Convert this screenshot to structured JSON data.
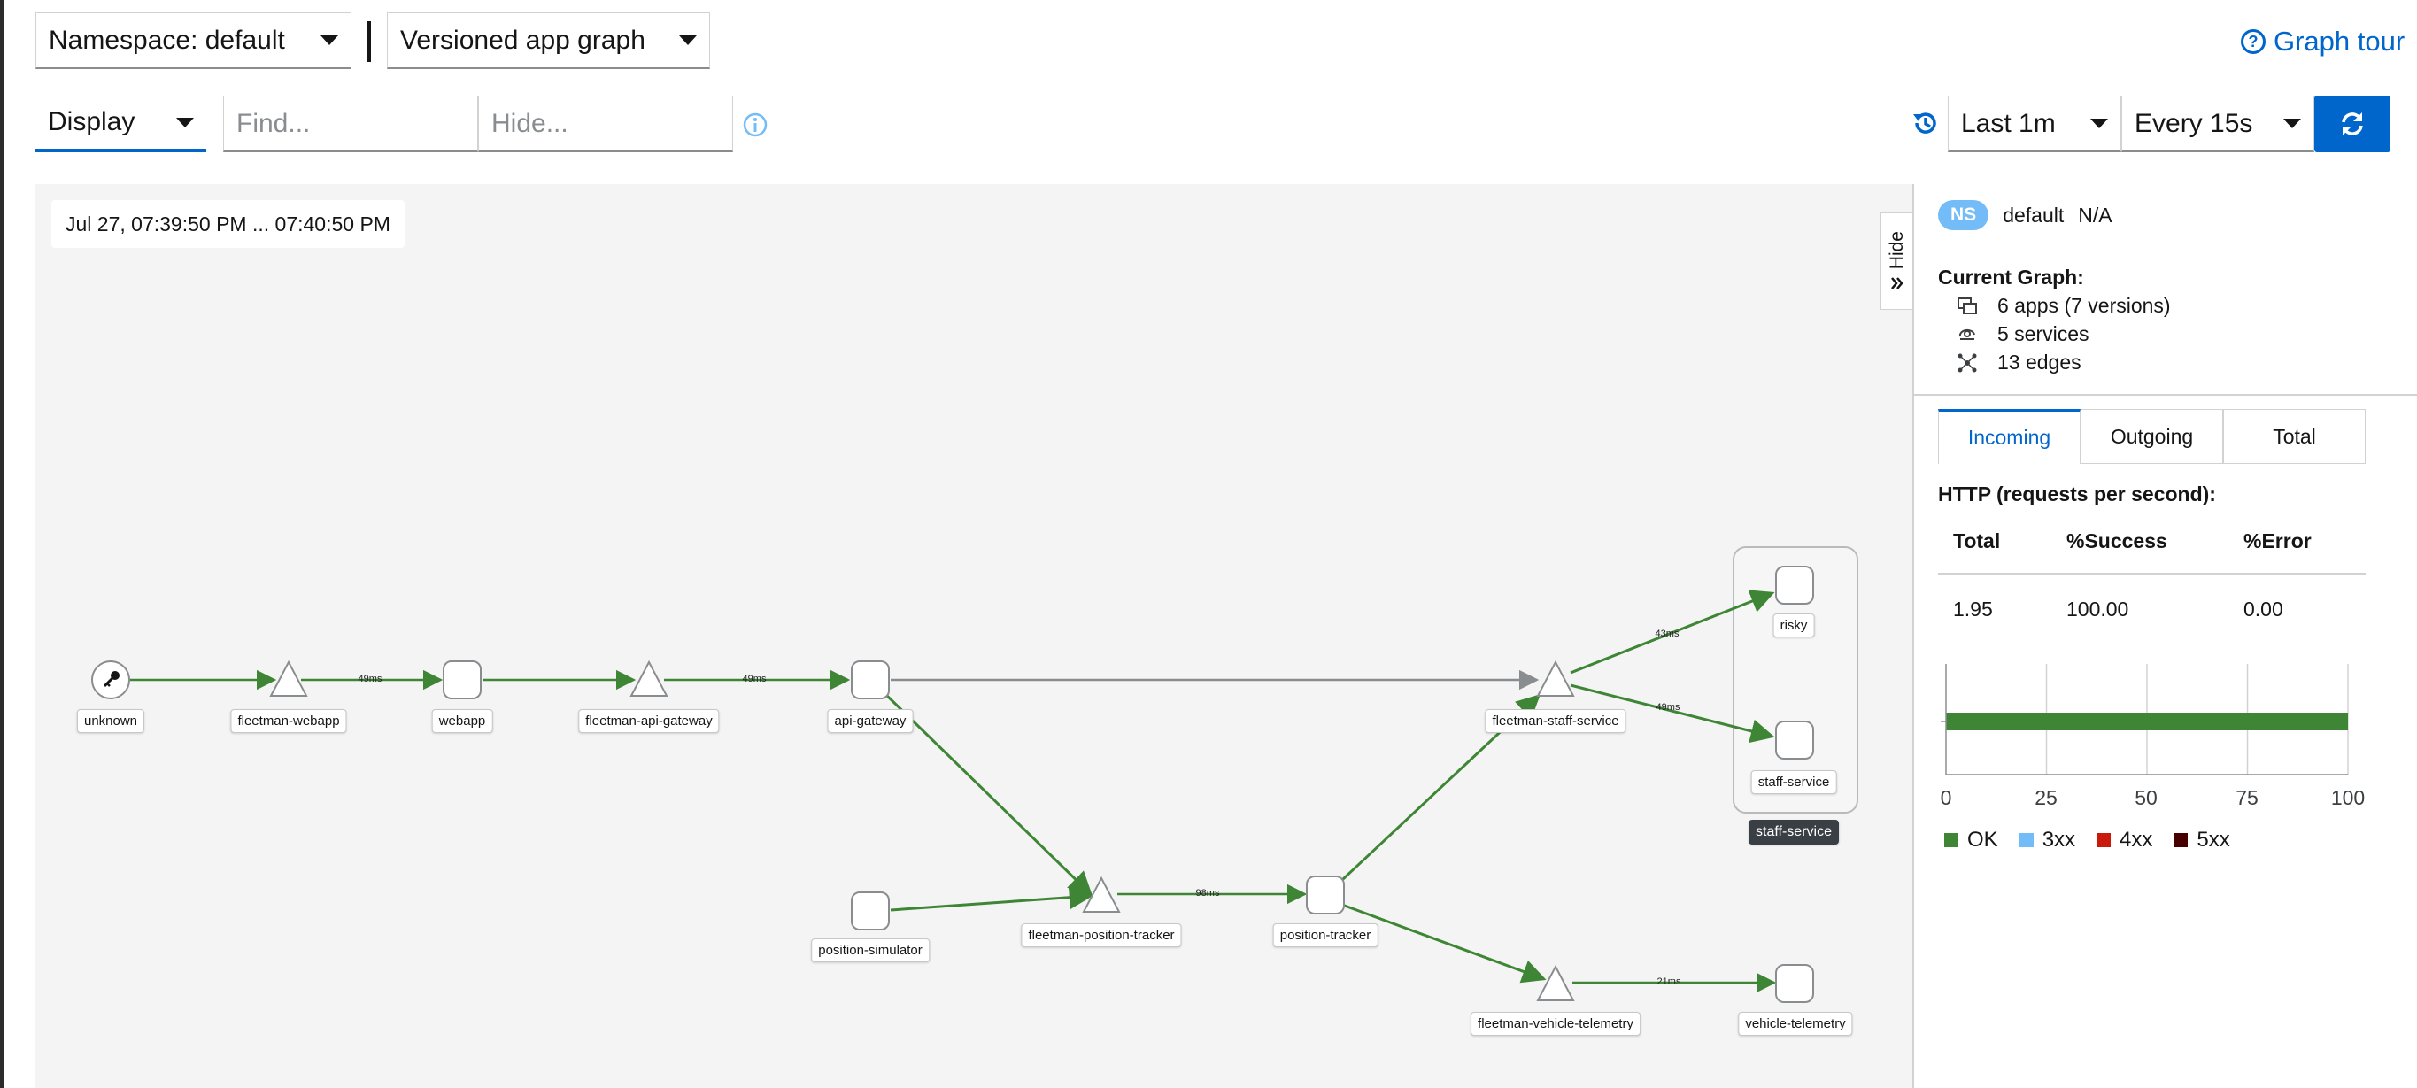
{
  "toolbar": {
    "namespace_label": "Namespace: default",
    "graph_type_label": "Versioned app graph",
    "graph_tour_label": "Graph tour",
    "display_label": "Display",
    "find_placeholder": "Find...",
    "hide_placeholder": "Hide...",
    "duration_label": "Last 1m",
    "refresh_interval_label": "Every 15s"
  },
  "graph": {
    "time_range": "Jul 27, 07:39:50 PM ... 07:40:50 PM",
    "nodes": {
      "unknown": "unknown",
      "fleetman_webapp": "fleetman-webapp",
      "webapp": "webapp",
      "fleetman_api_gateway": "fleetman-api-gateway",
      "api_gateway": "api-gateway",
      "fleetman_staff_service": "fleetman-staff-service",
      "risky": "risky",
      "staff_service_v": "staff-service",
      "staff_service_box": "staff-service",
      "position_simulator": "position-simulator",
      "fleetman_position_tracker": "fleetman-position-tracker",
      "position_tracker": "position-tracker",
      "fleetman_vehicle_telemetry": "fleetman-vehicle-telemetry",
      "vehicle_telemetry": "vehicle-telemetry"
    },
    "edges": {
      "webapp_rt": "49ms",
      "api_gateway_rt": "49ms",
      "risky_rt": "43ms",
      "staff_rt": "49ms",
      "position_rt": "98ms",
      "telemetry_rt": "21ms"
    },
    "colors": {
      "ok_edge": "#3e8635",
      "tcp_edge": "#8a8d90"
    }
  },
  "side_panel": {
    "hide_label": "Hide",
    "ns_badge": "NS",
    "namespace": "default",
    "namespace_extra": "N/A",
    "current_graph_title": "Current Graph:",
    "apps": "6 apps (7 versions)",
    "services": "5 services",
    "edges": "13 edges",
    "tabs": [
      "Incoming",
      "Outgoing",
      "Total"
    ],
    "http_title": "HTTP (requests per second):",
    "table": {
      "headers": [
        "Total",
        "%Success",
        "%Error"
      ],
      "row": [
        "1.95",
        "100.00",
        "0.00"
      ]
    },
    "chart_ticks": [
      "0",
      "25",
      "50",
      "75",
      "100"
    ],
    "legend": [
      {
        "label": "OK",
        "color": "#3e8635"
      },
      {
        "label": "3xx",
        "color": "#73bcf7"
      },
      {
        "label": "4xx",
        "color": "#c9190b"
      },
      {
        "label": "5xx",
        "color": "#470000"
      }
    ],
    "ok_percent": 100
  }
}
